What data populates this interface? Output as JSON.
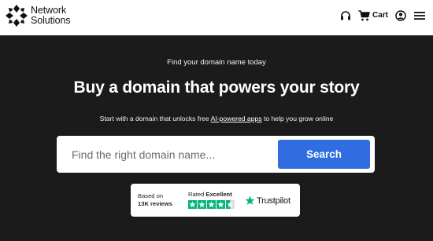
{
  "brand": {
    "line1": "Network",
    "line2": "Solutions"
  },
  "nav": {
    "support_icon": "headset-icon",
    "cart_icon": "cart-icon",
    "cart_label": "Cart",
    "account_icon": "account-icon",
    "menu_icon": "hamburger-menu-icon"
  },
  "hero": {
    "eyebrow": "Find your domain name today",
    "headline": "Buy a domain that powers your story",
    "sub_before": "Start with a domain that unlocks free ",
    "sub_link": "AI-powered apps",
    "sub_after": " to help you grow online"
  },
  "search": {
    "placeholder": "Find the right domain name...",
    "button_label": "Search"
  },
  "trust": {
    "based_on": "Based on",
    "review_count": "13K reviews",
    "rated_prefix": "Rated ",
    "rating_word": "Excellent",
    "star_rating": 4.5,
    "stars_total": 5,
    "provider": "Trustpilot"
  },
  "colors": {
    "hero_bg": "#1b1b1b",
    "search_button": "#2f6de1",
    "trustpilot_green": "#00b67a"
  }
}
